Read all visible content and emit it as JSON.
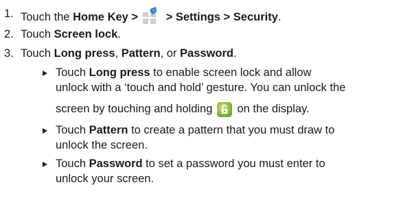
{
  "steps": [
    {
      "number": "1.",
      "pre": "Touch the ",
      "home_key": "Home Key >",
      "between": " > ",
      "settings_path": "Settings > Security",
      "end": ".",
      "apps_icon": "apps-launcher-icon"
    },
    {
      "number": "2.",
      "pre": "Touch ",
      "screen_lock": "Screen lock",
      "end": "."
    },
    {
      "number": "3.",
      "pre": "Touch ",
      "long_press": "Long press",
      "sep1": ", ",
      "pattern": "Pattern",
      "sep2": ", or ",
      "password": "Password",
      "end": "."
    }
  ],
  "bullets": [
    {
      "pre": "Touch ",
      "bold": "Long press",
      "line1_rest": " to enable screen lock and allow",
      "line2": "unlock with a ‘touch and hold’ gesture. You can unlock the",
      "line3_pre": "screen by touching and holding",
      "line3_post": "on the display.",
      "icon": "unlock-icon"
    },
    {
      "pre": "Touch ",
      "bold": "Pattern",
      "line1_rest": " to create a pattern that you must draw to",
      "line2": "unlock the screen."
    },
    {
      "pre": "Touch ",
      "bold": "Password",
      "line1_rest": " to set a password you must enter to",
      "line2": "unlock your screen."
    }
  ],
  "colors": {
    "text": "#1a1a1a",
    "apps_icon_blue": "#1e6fd9",
    "apps_icon_grey": "#c9ced3",
    "unlock_icon_green": "#8cc53f"
  }
}
